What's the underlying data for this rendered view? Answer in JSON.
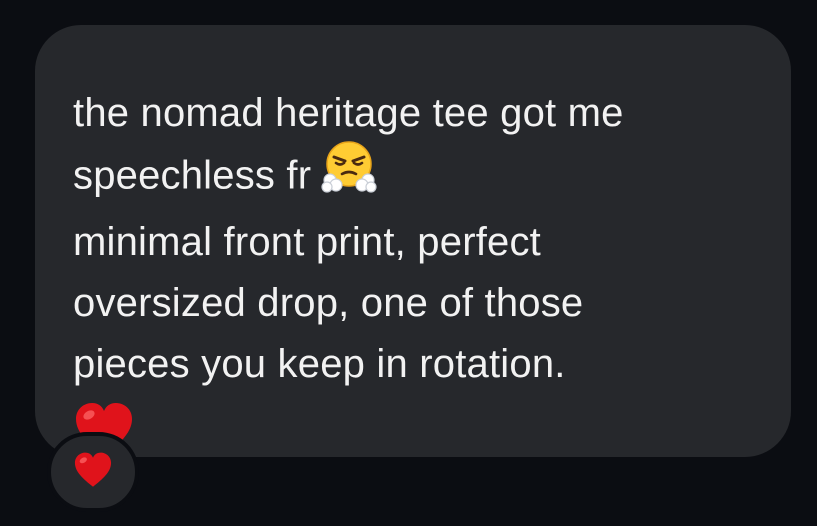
{
  "message": {
    "lines": [
      "the nomad heritage tee got me",
      "speechless fr",
      "minimal front print, perfect",
      "oversized drop, one of those",
      "pieces you keep in rotation."
    ],
    "inline_emoji": "face-with-steam-from-nose-icon",
    "trailing_emoji": "red-heart-icon"
  },
  "reaction": {
    "emoji": "red-heart-icon"
  },
  "colors": {
    "background": "#0b0d12",
    "bubble": "#26282c",
    "text": "#f2f2f2",
    "heart": "#e0131b",
    "emoji_face": "#ffcc33"
  }
}
